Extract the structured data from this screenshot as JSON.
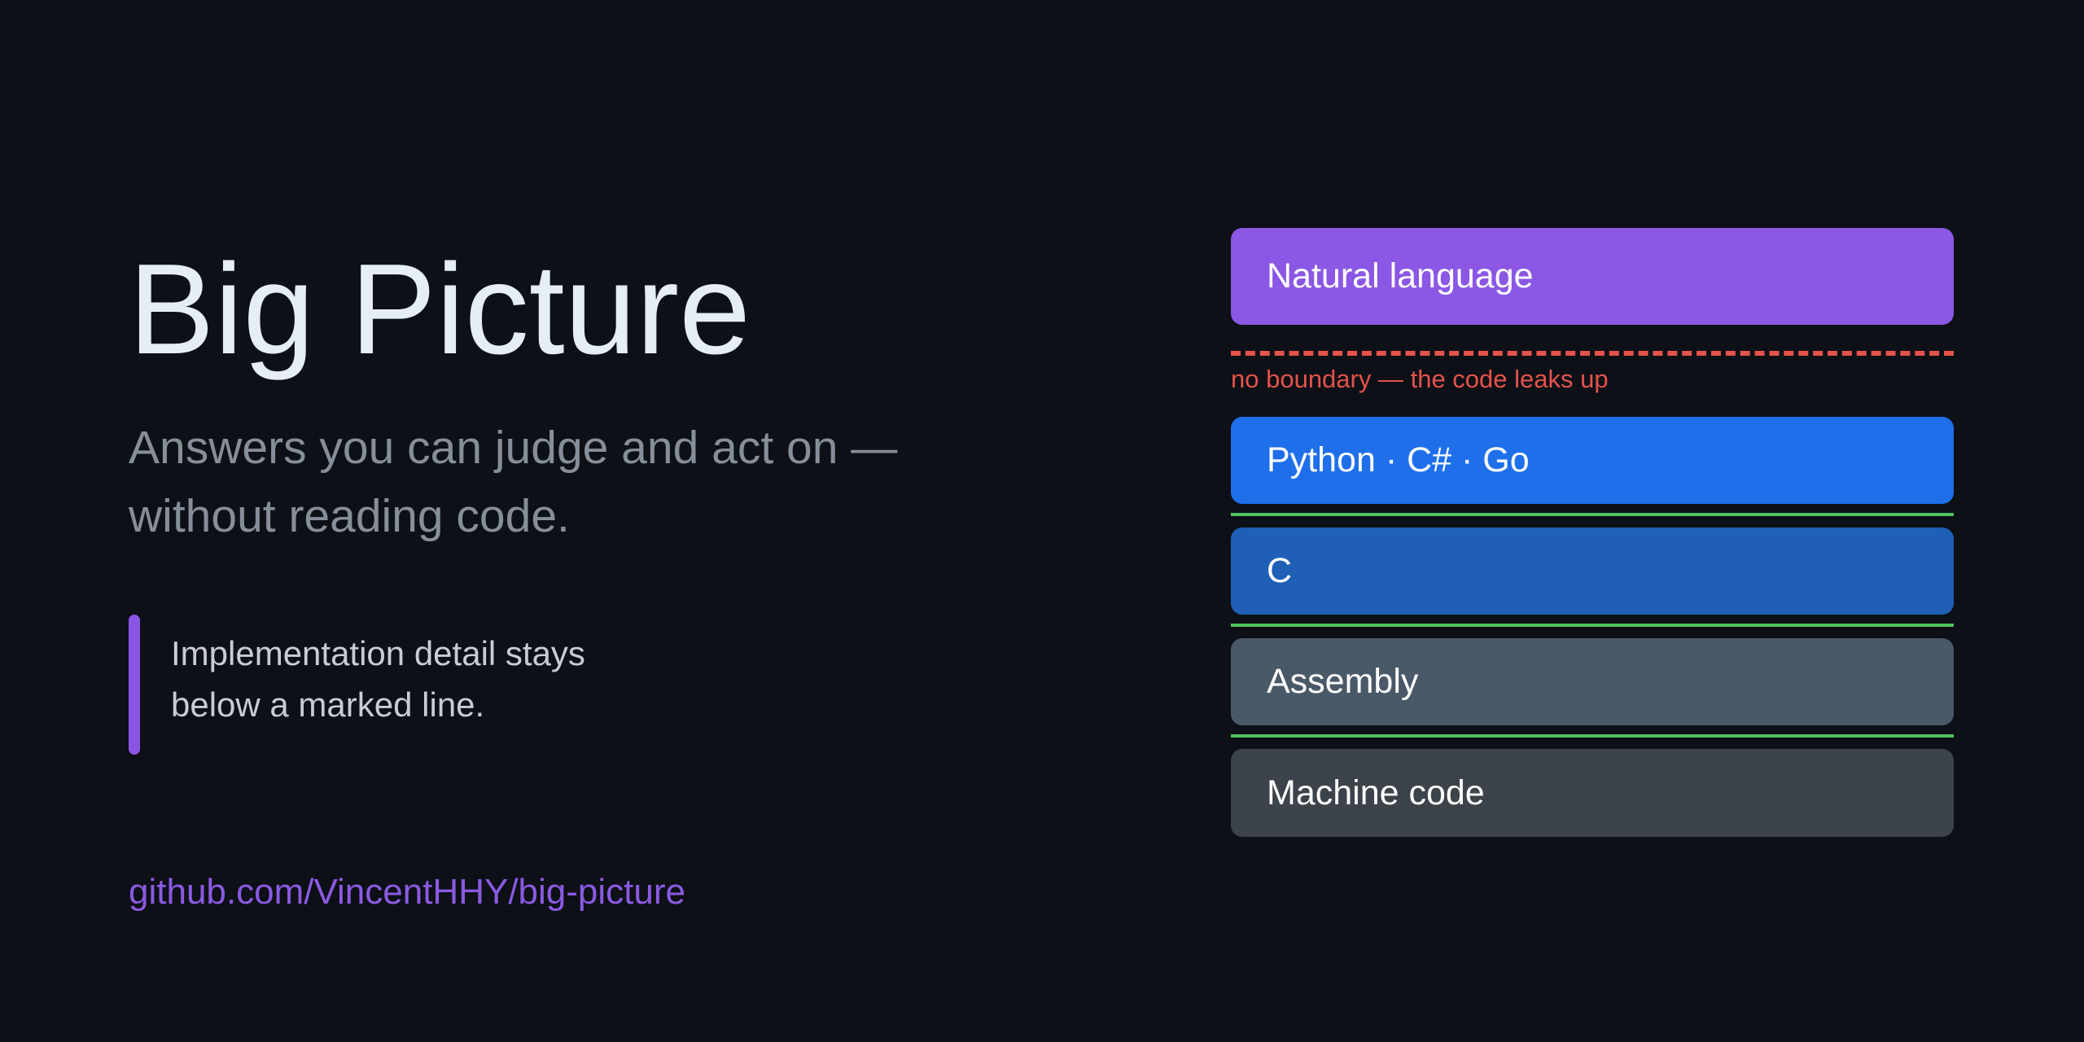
{
  "hero": {
    "title": "Big Picture",
    "subtitle": "Answers you can judge and act on — without reading code.",
    "callout": "Implementation detail stays below a marked line.",
    "link": "github.com/VincentHHY/big-picture"
  },
  "stack": {
    "boundary_note": "no boundary — the code leaks up",
    "layers": [
      {
        "label": "Natural language",
        "color": "#8b57e4"
      },
      {
        "label": "Python · C# · Go",
        "color": "#1f6feb"
      },
      {
        "label": "C",
        "color": "#1f5fb6"
      },
      {
        "label": "Assembly",
        "color": "#4a5968"
      },
      {
        "label": "Machine code",
        "color": "#3d434b"
      }
    ]
  },
  "colors": {
    "background": "#0d1017",
    "accent": "#8a55e5",
    "warning": "#e5534b",
    "boundary": "#4fc25e"
  }
}
